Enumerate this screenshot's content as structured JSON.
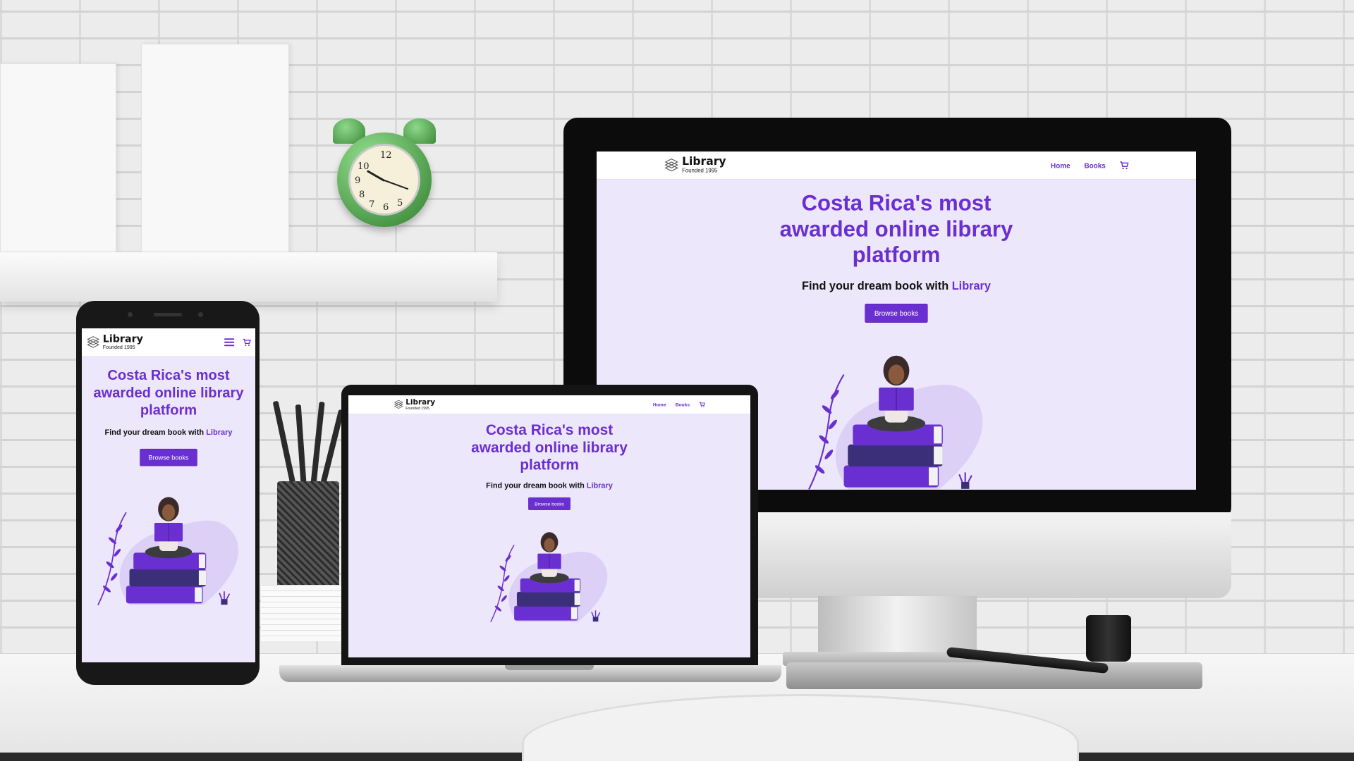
{
  "site": {
    "logo_title": "Library",
    "logo_sub": "Founded 1995",
    "nav": {
      "home": "Home",
      "books": "Books"
    },
    "headline": "Costa Rica's most awarded online library platform",
    "sub_prefix": "Find your dream book with",
    "sub_accent": "Library",
    "cta": "Browse books"
  },
  "icons": {
    "logo": "stacked-books-icon",
    "cart": "cart-icon",
    "menu": "hamburger-menu-icon"
  },
  "colors": {
    "accent": "#6a2fd0",
    "hero_bg": "#ede7fb",
    "nav_bg": "#ffffff",
    "text": "#111111"
  },
  "clock_numerals": [
    "12",
    "10",
    "9",
    "8",
    "7",
    "6",
    "5"
  ]
}
